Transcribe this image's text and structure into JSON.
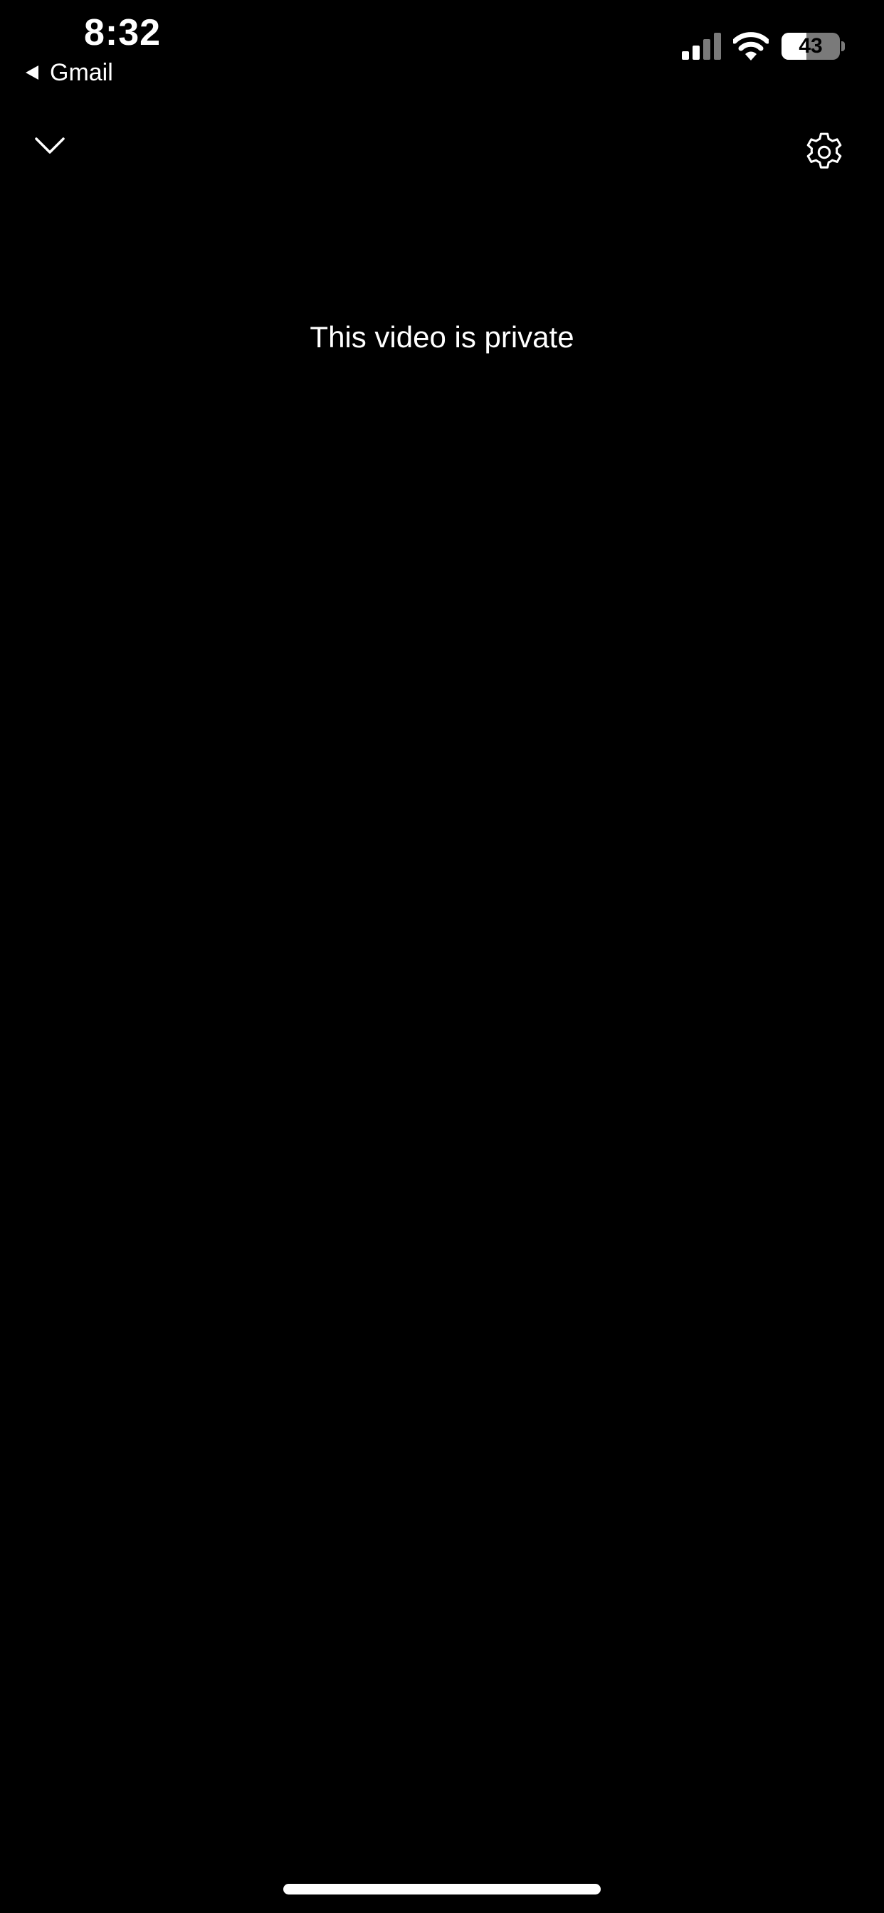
{
  "status_bar": {
    "time": "8:32",
    "back_app": "Gmail",
    "battery_percent": "43",
    "battery_level": 0.43,
    "signal_bars_active": 2,
    "signal_bars_total": 4,
    "icons": [
      "signal-icon",
      "wifi-icon",
      "battery-icon"
    ]
  },
  "toolbar": {
    "collapse_icon": "chevron-down-icon",
    "settings_icon": "gear-icon"
  },
  "player": {
    "message": "This video is private"
  },
  "colors": {
    "background": "#000000",
    "foreground": "#ffffff",
    "inactive": "#7a7a7a"
  }
}
